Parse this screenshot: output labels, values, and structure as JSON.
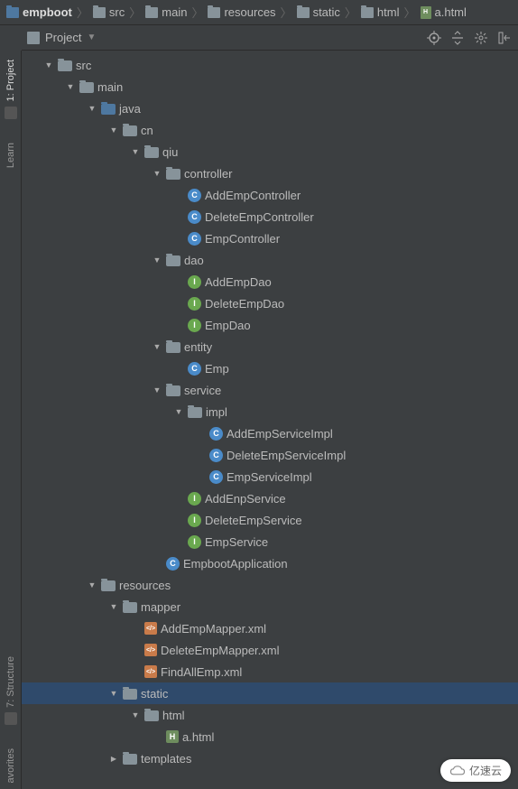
{
  "breadcrumbs": [
    {
      "label": "empboot",
      "bold": true,
      "icon": "mod"
    },
    {
      "label": "src",
      "icon": "folder"
    },
    {
      "label": "main",
      "icon": "folder"
    },
    {
      "label": "resources",
      "icon": "folder"
    },
    {
      "label": "static",
      "icon": "folder"
    },
    {
      "label": "html",
      "icon": "folder"
    },
    {
      "label": "a.html",
      "icon": "html"
    }
  ],
  "toolbar": {
    "title": "Project"
  },
  "gutter": {
    "project": "1: Project",
    "learn": "Learn",
    "structure": "7: Structure",
    "favorites": "avorites"
  },
  "tree": [
    {
      "d": 0,
      "a": "down",
      "i": "folder",
      "l": "src"
    },
    {
      "d": 1,
      "a": "down",
      "i": "folder",
      "l": "main"
    },
    {
      "d": 2,
      "a": "down",
      "i": "folder src",
      "l": "java"
    },
    {
      "d": 3,
      "a": "down",
      "i": "folder pkg",
      "l": "cn"
    },
    {
      "d": 4,
      "a": "down",
      "i": "folder pkg",
      "l": "qiu"
    },
    {
      "d": 5,
      "a": "down",
      "i": "folder pkg",
      "l": "controller"
    },
    {
      "d": 6,
      "a": "",
      "i": "class-c",
      "t": "C",
      "l": "AddEmpController"
    },
    {
      "d": 6,
      "a": "",
      "i": "class-c",
      "t": "C",
      "l": "DeleteEmpController"
    },
    {
      "d": 6,
      "a": "",
      "i": "class-c",
      "t": "C",
      "l": "EmpController"
    },
    {
      "d": 5,
      "a": "down",
      "i": "folder pkg",
      "l": "dao"
    },
    {
      "d": 6,
      "a": "",
      "i": "class-i",
      "t": "I",
      "l": "AddEmpDao"
    },
    {
      "d": 6,
      "a": "",
      "i": "class-i",
      "t": "I",
      "l": "DeleteEmpDao"
    },
    {
      "d": 6,
      "a": "",
      "i": "class-i",
      "t": "I",
      "l": "EmpDao"
    },
    {
      "d": 5,
      "a": "down",
      "i": "folder pkg",
      "l": "entity"
    },
    {
      "d": 6,
      "a": "",
      "i": "class-c",
      "t": "C",
      "l": "Emp"
    },
    {
      "d": 5,
      "a": "down",
      "i": "folder pkg",
      "l": "service"
    },
    {
      "d": 6,
      "a": "down",
      "i": "folder pkg",
      "l": "impl"
    },
    {
      "d": 7,
      "a": "",
      "i": "class-c",
      "t": "C",
      "l": "AddEmpServiceImpl"
    },
    {
      "d": 7,
      "a": "",
      "i": "class-c",
      "t": "C",
      "l": "DeleteEmpServiceImpl"
    },
    {
      "d": 7,
      "a": "",
      "i": "class-c",
      "t": "C",
      "l": "EmpServiceImpl"
    },
    {
      "d": 6,
      "a": "",
      "i": "class-i",
      "t": "I",
      "l": "AddEnpService"
    },
    {
      "d": 6,
      "a": "",
      "i": "class-i",
      "t": "I",
      "l": "DeleteEmpService"
    },
    {
      "d": 6,
      "a": "",
      "i": "class-i",
      "t": "I",
      "l": "EmpService"
    },
    {
      "d": 5,
      "a": "",
      "i": "class-c2",
      "t": "C",
      "l": "EmpbootApplication"
    },
    {
      "d": 2,
      "a": "down",
      "i": "folder res",
      "l": "resources"
    },
    {
      "d": 3,
      "a": "down",
      "i": "folder pkg",
      "l": "mapper"
    },
    {
      "d": 4,
      "a": "",
      "i": "xml",
      "t": "</>",
      "l": "AddEmpMapper.xml"
    },
    {
      "d": 4,
      "a": "",
      "i": "xml",
      "t": "</>",
      "l": "DeleteEmpMapper.xml"
    },
    {
      "d": 4,
      "a": "",
      "i": "xml",
      "t": "</>",
      "l": "FindAllEmp.xml"
    },
    {
      "d": 3,
      "a": "down",
      "i": "folder pkg",
      "l": "static",
      "sel": true
    },
    {
      "d": 4,
      "a": "down",
      "i": "folder pkg",
      "l": "html"
    },
    {
      "d": 5,
      "a": "",
      "i": "html",
      "t": "H",
      "l": "a.html"
    },
    {
      "d": 3,
      "a": "right",
      "i": "folder pkg",
      "l": "templates"
    }
  ],
  "watermark": "亿速云"
}
